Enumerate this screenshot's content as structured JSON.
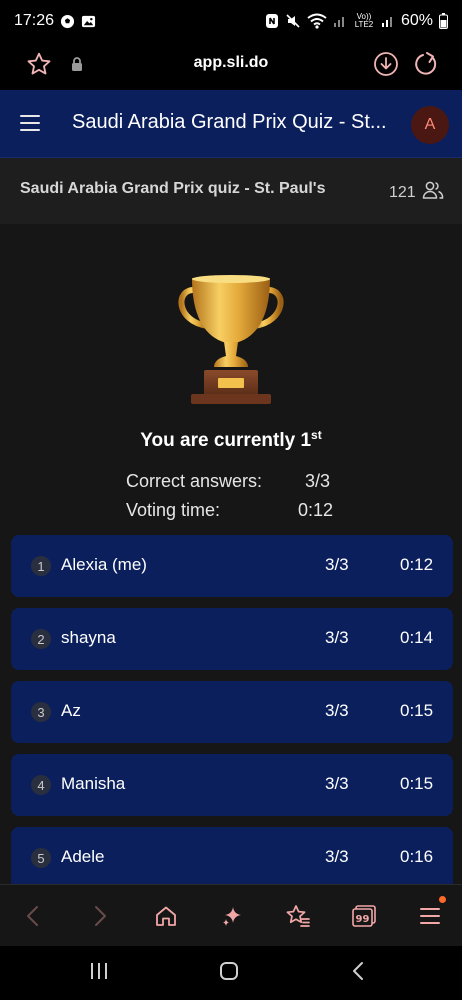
{
  "status_bar": {
    "time": "17:26",
    "battery": "60%",
    "lte": "Vo)) LTE2"
  },
  "browser": {
    "url": "app.sli.do"
  },
  "app": {
    "title": "Saudi Arabia Grand Prix Quiz - St...",
    "avatar_initial": "A",
    "event_title": "Saudi Arabia Grand Prix quiz - St. Paul's",
    "participant_count": "121"
  },
  "result": {
    "rank_prefix": "You are currently 1",
    "rank_suffix": "st",
    "correct_label": "Correct answers:",
    "correct_value": "3/3",
    "time_label": "Voting time:",
    "time_value": "0:12"
  },
  "leaderboard": [
    {
      "rank": "1",
      "name": "Alexia (me)",
      "score": "3/3",
      "time": "0:12"
    },
    {
      "rank": "2",
      "name": "shayna",
      "score": "3/3",
      "time": "0:14"
    },
    {
      "rank": "3",
      "name": "Az",
      "score": "3/3",
      "time": "0:15"
    },
    {
      "rank": "4",
      "name": "Manisha",
      "score": "3/3",
      "time": "0:15"
    },
    {
      "rank": "5",
      "name": "Adele",
      "score": "3/3",
      "time": "0:16"
    }
  ],
  "colors": {
    "header_bg": "#0b1f5c",
    "row_bg": "#0b1f5c",
    "page_bg": "#161616",
    "nav_icon": "#f2a7a7",
    "avatar_bg": "#4a1712",
    "avatar_text": "#ff8a78",
    "notif_dot": "#ff6a2a"
  },
  "icons": {
    "status": [
      "soccer-ball-icon",
      "gallery-icon",
      "nfc-icon",
      "mute-icon",
      "wifi-icon",
      "signal-icon",
      "battery-icon"
    ],
    "bottom_nav": [
      "back-arrow-icon",
      "forward-arrow-icon",
      "home-icon",
      "sparkle-icon",
      "star-list-icon",
      "quote-icon",
      "menu-icon"
    ]
  }
}
